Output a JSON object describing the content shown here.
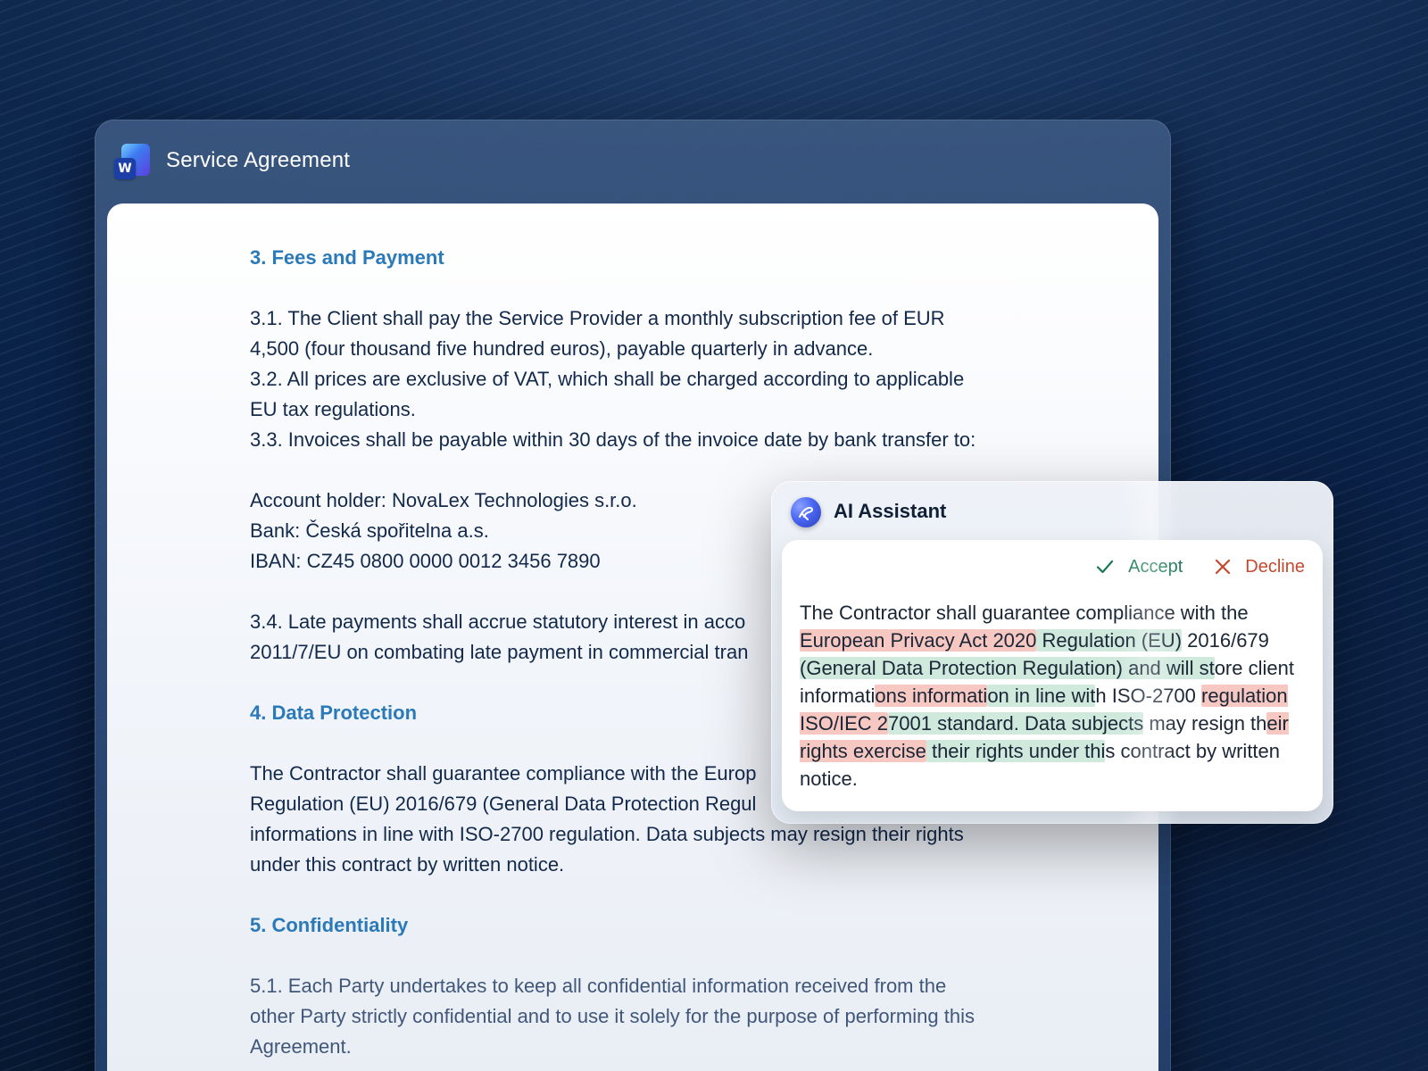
{
  "window": {
    "title": "Service Agreement",
    "app_icon_letter": "W"
  },
  "document": {
    "section3": {
      "heading": "3. Fees and Payment",
      "p1_line1": "3.1. The Client shall pay the Service Provider a monthly subscription fee of EUR",
      "p1_line2": "4,500 (four thousand five hundred euros), payable quarterly in advance.",
      "p2_line1": "3.2. All prices are exclusive of VAT, which shall be charged according to applicable",
      "p2_line2": "EU tax regulations.",
      "p3_line1": "3.3. Invoices shall be payable within 30 days of the invoice date by bank transfer to:",
      "account_holder": "Account holder: NovaLex Technologies s.r.o.",
      "bank": "Bank: Česká spořitelna a.s.",
      "iban": "IBAN: CZ45 0800 0000 0012 3456 7890",
      "p4_line1": "3.4. Late payments shall accrue statutory interest in acco",
      "p4_line2": "2011/7/EU on combating late payment in commercial tran"
    },
    "section4": {
      "heading": "4. Data Protection",
      "p_line1": "The Contractor shall guarantee compliance with the Europ",
      "p_line2": "Regulation (EU) 2016/679 (General Data Protection Regul",
      "p_line3": "informations in line with ISO-2700 regulation. Data subjects may resign their rights",
      "p_line4": "under this contract by written notice."
    },
    "section5": {
      "heading": "5. Confidentiality",
      "p_line1": "5.1. Each Party undertakes to keep all confidential information received from the",
      "p_line2": "other Party strictly confidential and to use it solely for the purpose of performing this",
      "p_line3": "Agreement."
    }
  },
  "ai_assistant": {
    "title": "AI Assistant",
    "accept_label": "Accept",
    "decline_label": "Decline",
    "suggestion": {
      "t1": "The Contractor shall guarantee compliance with the ",
      "del1": "European Privacy Act 2020",
      "ins1": " Regulation (EU)",
      "t2": " 2016/679 ",
      "ins2": "(General Data Protection Regulation) and will st",
      "t3": "ore client informati",
      "del2": "ons informati",
      "ins3": "on in line wit",
      "t4": "h ISO-2700 ",
      "del3": "regulation ISO/IEC 2",
      "ins4": "7001 standard. Data subjects",
      "t5": " may resign th",
      "del4": "eir rights exercise",
      "ins5": " their rights under thi",
      "t6": "s contract by written notice."
    }
  },
  "colors": {
    "heading_blue": "#2a79b8",
    "accept_green": "#1a7a56",
    "decline_red": "#c34a2e",
    "deletion_highlight": "#f7c8c2",
    "insertion_highlight": "#cfe9dd"
  },
  "icons": {
    "app": "word-icon",
    "assistant": "ai-assistant-logo-icon",
    "accept": "check-icon",
    "decline": "close-icon"
  }
}
